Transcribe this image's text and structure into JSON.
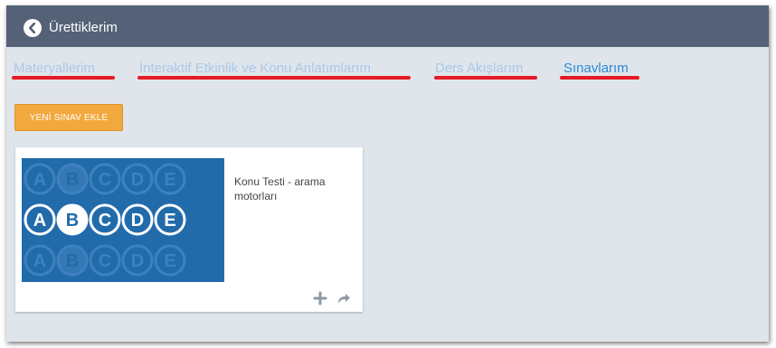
{
  "header": {
    "title": "Ürettiklerim",
    "back_icon": "circle-chevron-left-icon"
  },
  "tabs": [
    {
      "label": "Materyallerim",
      "active": false
    },
    {
      "label": "İnteraktif Etkinlik ve Konu Anlatımlarım",
      "active": false
    },
    {
      "label": "Ders Akışlarım",
      "active": false
    },
    {
      "label": "Sınavlarım",
      "active": true
    }
  ],
  "actions": {
    "add_exam_label": "YENİ SINAV EKLE"
  },
  "cards": [
    {
      "title": "Konu Testi - arama motorları",
      "thumbnail": {
        "letters": [
          "A",
          "B",
          "C",
          "D",
          "E"
        ],
        "icon": "multiple-choice-bubbles-icon"
      },
      "action_icons": [
        "plus-icon",
        "share-arrow-icon"
      ]
    }
  ],
  "colors": {
    "header_bg": "#546177",
    "tab_inactive": "#a9c8ea",
    "tab_active": "#2b8ad9",
    "underline": "#e41b23",
    "button_bg": "#f3a83d",
    "thumb_bg": "#226bab"
  }
}
